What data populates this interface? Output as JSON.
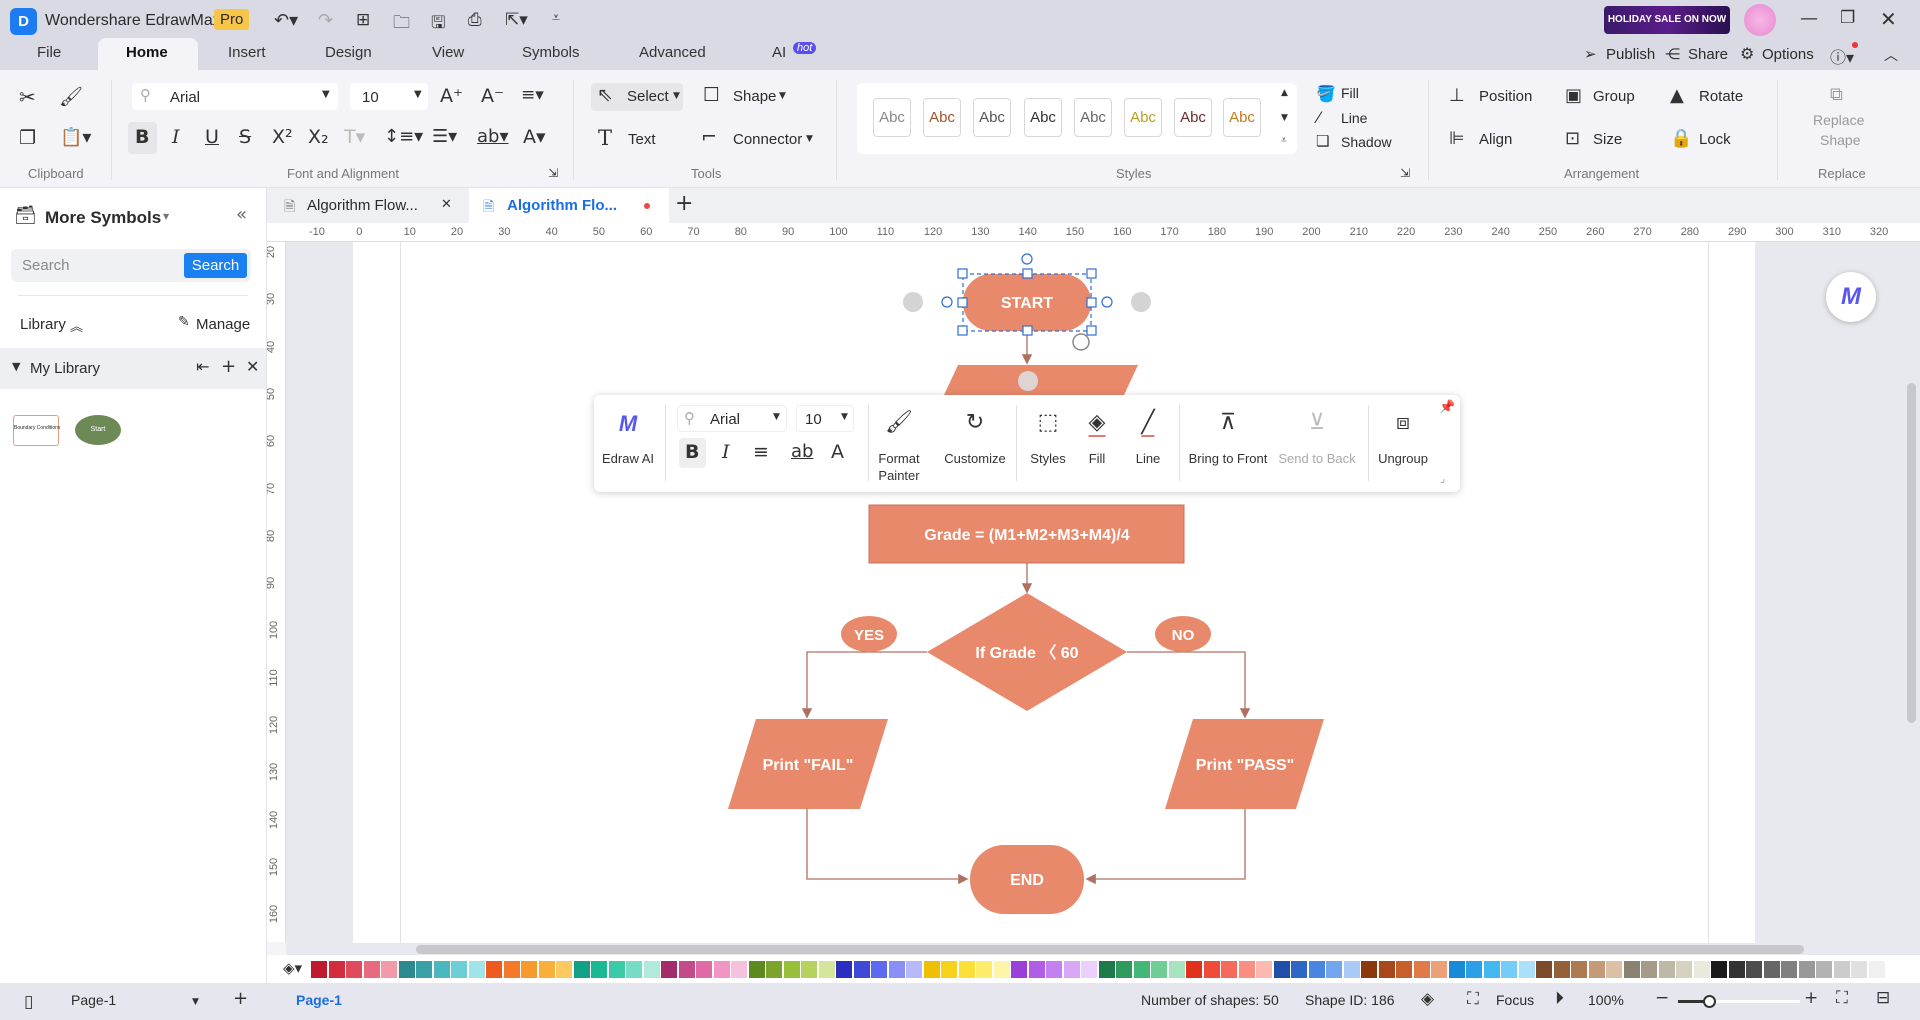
{
  "app": {
    "title": "Wondershare EdrawMax",
    "badge": "Pro",
    "promo": "HOLIDAY SALE ON NOW"
  },
  "menu_tabs": [
    "File",
    "Home",
    "Insert",
    "Design",
    "View",
    "Symbols",
    "Advanced",
    "AI"
  ],
  "ai_badge": "hot",
  "top_actions": {
    "publish": "Publish",
    "share": "Share",
    "options": "Options"
  },
  "ribbon": {
    "font": "Arial",
    "size": "10",
    "groups": {
      "clipboard": "Clipboard",
      "font": "Font and Alignment",
      "tools": "Tools",
      "styles": "Styles",
      "arrangement": "Arrangement",
      "replace": "Replace"
    },
    "tools": {
      "select": "Select",
      "shape": "Shape",
      "text": "Text",
      "connector": "Connector"
    },
    "style_samples": [
      "Abc",
      "Abc",
      "Abc",
      "Abc",
      "Abc",
      "Abc",
      "Abc",
      "Abc"
    ],
    "style_colors": [
      "#888888",
      "#a0522d",
      "#555555",
      "#333333",
      "#666666",
      "#b8a020",
      "#6b2a2a",
      "#c07a20"
    ],
    "fill": "Fill",
    "line": "Line",
    "shadow": "Shadow",
    "arrangement": {
      "position": "Position",
      "group": "Group",
      "rotate": "Rotate",
      "align": "Align",
      "size": "Size",
      "lock": "Lock"
    },
    "replace_shape": [
      "Replace",
      "Shape"
    ]
  },
  "left_panel": {
    "title": "More Symbols",
    "search_placeholder": "Search",
    "search_button": "Search",
    "library": "Library",
    "manage": "Manage",
    "my_library": "My Library",
    "thumbs": [
      "Boundary Conditions",
      "Start"
    ]
  },
  "doc_tabs": [
    {
      "label": "Algorithm Flow..."
    },
    {
      "label": "Algorithm Flo..."
    }
  ],
  "ruler_h": [
    "-10",
    "0",
    "10",
    "20",
    "30",
    "40",
    "50",
    "60",
    "70",
    "80",
    "90",
    "100",
    "110",
    "120",
    "130",
    "140",
    "150",
    "160",
    "170",
    "180",
    "190",
    "200",
    "210",
    "220",
    "230",
    "240",
    "250",
    "260",
    "270",
    "280",
    "290",
    "300",
    "310",
    "320"
  ],
  "ruler_v": [
    "20",
    "30",
    "40",
    "50",
    "60",
    "70",
    "80",
    "90",
    "100",
    "110",
    "120",
    "130",
    "140",
    "150",
    "160"
  ],
  "floating_toolbar": {
    "edraw_ai": "Edraw AI",
    "font": "Arial",
    "size": "10",
    "format_painter": [
      "Format",
      "Painter"
    ],
    "customize": "Customize",
    "styles": "Styles",
    "fill": "Fill",
    "line": "Line",
    "bring_front": "Bring to Front",
    "send_back": "Send to Back",
    "ungroup": "Ungroup"
  },
  "diagram": {
    "fill": "#e8896b",
    "start": "START",
    "process": "Grade = (M1+M2+M3+M4)/4",
    "decision": "If Grade 〈 60",
    "yes": "YES",
    "no": "NO",
    "fail": "Print \"FAIL\"",
    "pass": "Print \"PASS\"",
    "end": "END"
  },
  "palette": [
    "#c0182c",
    "#d22b3c",
    "#e04a5d",
    "#e86b7d",
    "#f29aa8",
    "#2a8a8f",
    "#3aa0a8",
    "#4bb8c0",
    "#6ccfd6",
    "#a0e3e8",
    "#f05a22",
    "#f47a2a",
    "#f79a2e",
    "#f9b03a",
    "#fbc862",
    "#14a085",
    "#1cb894",
    "#3cc9a8",
    "#76dcc4",
    "#b0eadb",
    "#a22d6a",
    "#c44a8a",
    "#e06aa6",
    "#f095c4",
    "#f7c0dc",
    "#5c8a1e",
    "#7aa52a",
    "#98bf3a",
    "#b6d25c",
    "#d4e69a",
    "#2a2fc0",
    "#3f4ad8",
    "#5d6af0",
    "#8a8ff5",
    "#b8b9fa",
    "#f0c000",
    "#f7d21a",
    "#fbe03a",
    "#fdeb6a",
    "#fff5a8",
    "#9a3fd8",
    "#b05ee6",
    "#c47ff0",
    "#d8a6f6",
    "#ebd0fb",
    "#1e7a4a",
    "#2e9a5e",
    "#44b676",
    "#6fcd95",
    "#a8e3bf",
    "#e0301e",
    "#f04a3a",
    "#f56a5a",
    "#f98f82",
    "#fcb9b0",
    "#1f4fa8",
    "#2e66c8",
    "#4a86e0",
    "#74a6ee",
    "#a9c9f6",
    "#8a3a0a",
    "#a8481a",
    "#c85e2a",
    "#e07a48",
    "#eca07a",
    "#1a8ad8",
    "#2aa0e8",
    "#44b6f0",
    "#74cdf6",
    "#acdffa",
    "#7a4a2a",
    "#94603a",
    "#ae7a54",
    "#c69a78",
    "#dcc0a6",
    "#8a8270",
    "#a49c88",
    "#beb8a6",
    "#d6d2c2",
    "#ebe8dc",
    "#1a1a1a",
    "#333333",
    "#4d4d4d",
    "#666666",
    "#808080",
    "#999999",
    "#b3b3b3",
    "#cccccc",
    "#e0e0e0",
    "#f0f0f0"
  ],
  "status": {
    "page_select": "Page-1",
    "page_tab": "Page-1",
    "shapes": "Number of shapes: 50",
    "shape_id": "Shape ID: 186",
    "focus": "Focus",
    "zoom": "100%",
    "zoom_level": 100
  }
}
